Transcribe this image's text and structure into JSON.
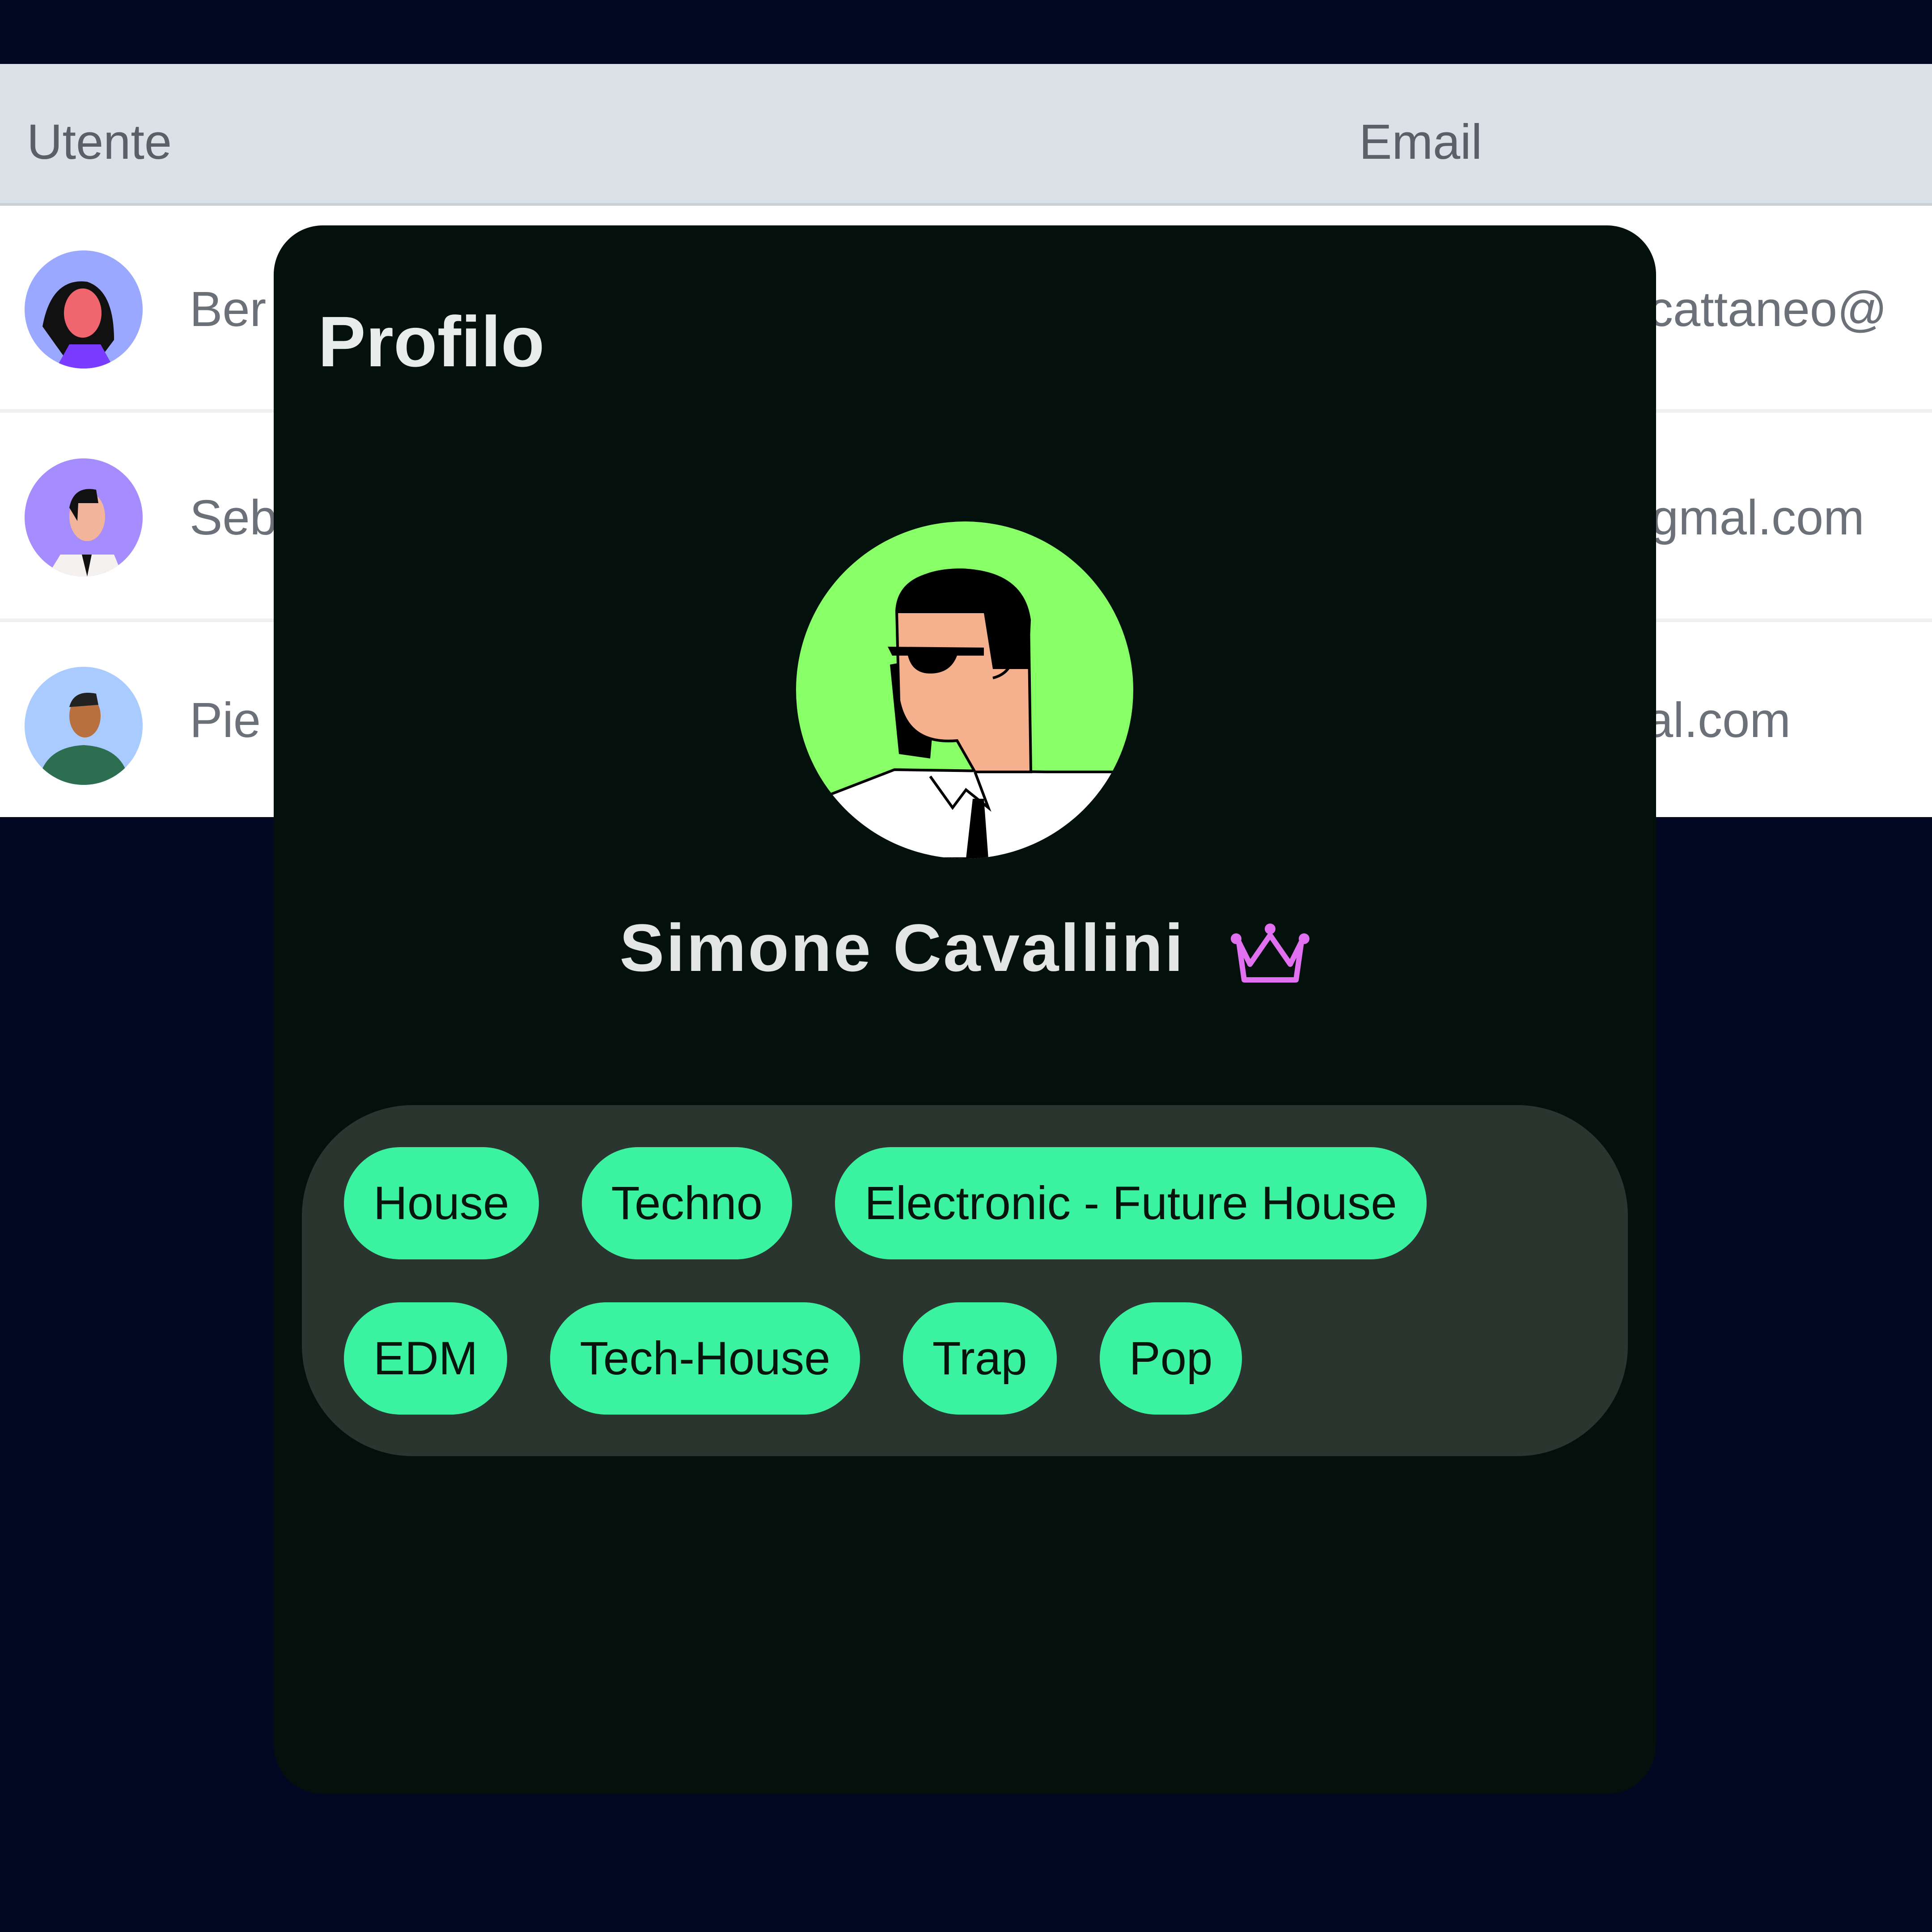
{
  "table": {
    "headers": {
      "user": "Utente",
      "email": "Email"
    },
    "rows": [
      {
        "name": "Ber",
        "email": "cattaneo@",
        "avatar_bg": "#9aa8ff"
      },
      {
        "name": "Seb",
        "email": "gmal.com",
        "avatar_bg": "#a58cff"
      },
      {
        "name": "Pie",
        "email": "al.com",
        "avatar_bg": "#a9cbff"
      }
    ]
  },
  "modal": {
    "title": "Profilo",
    "user_name": "Simone Cavallini",
    "badge_icon": "crown-icon",
    "avatar_bg": "#88ff66",
    "tags": [
      "House",
      "Techno",
      "Electronic - Future House",
      "EDM",
      "Tech-House",
      "Trap",
      "Pop"
    ]
  },
  "colors": {
    "background": "#030822",
    "modal": "#04100c",
    "tag": "#3af29f",
    "tag_panel": "#2a3530",
    "crown": "#e070f0"
  }
}
